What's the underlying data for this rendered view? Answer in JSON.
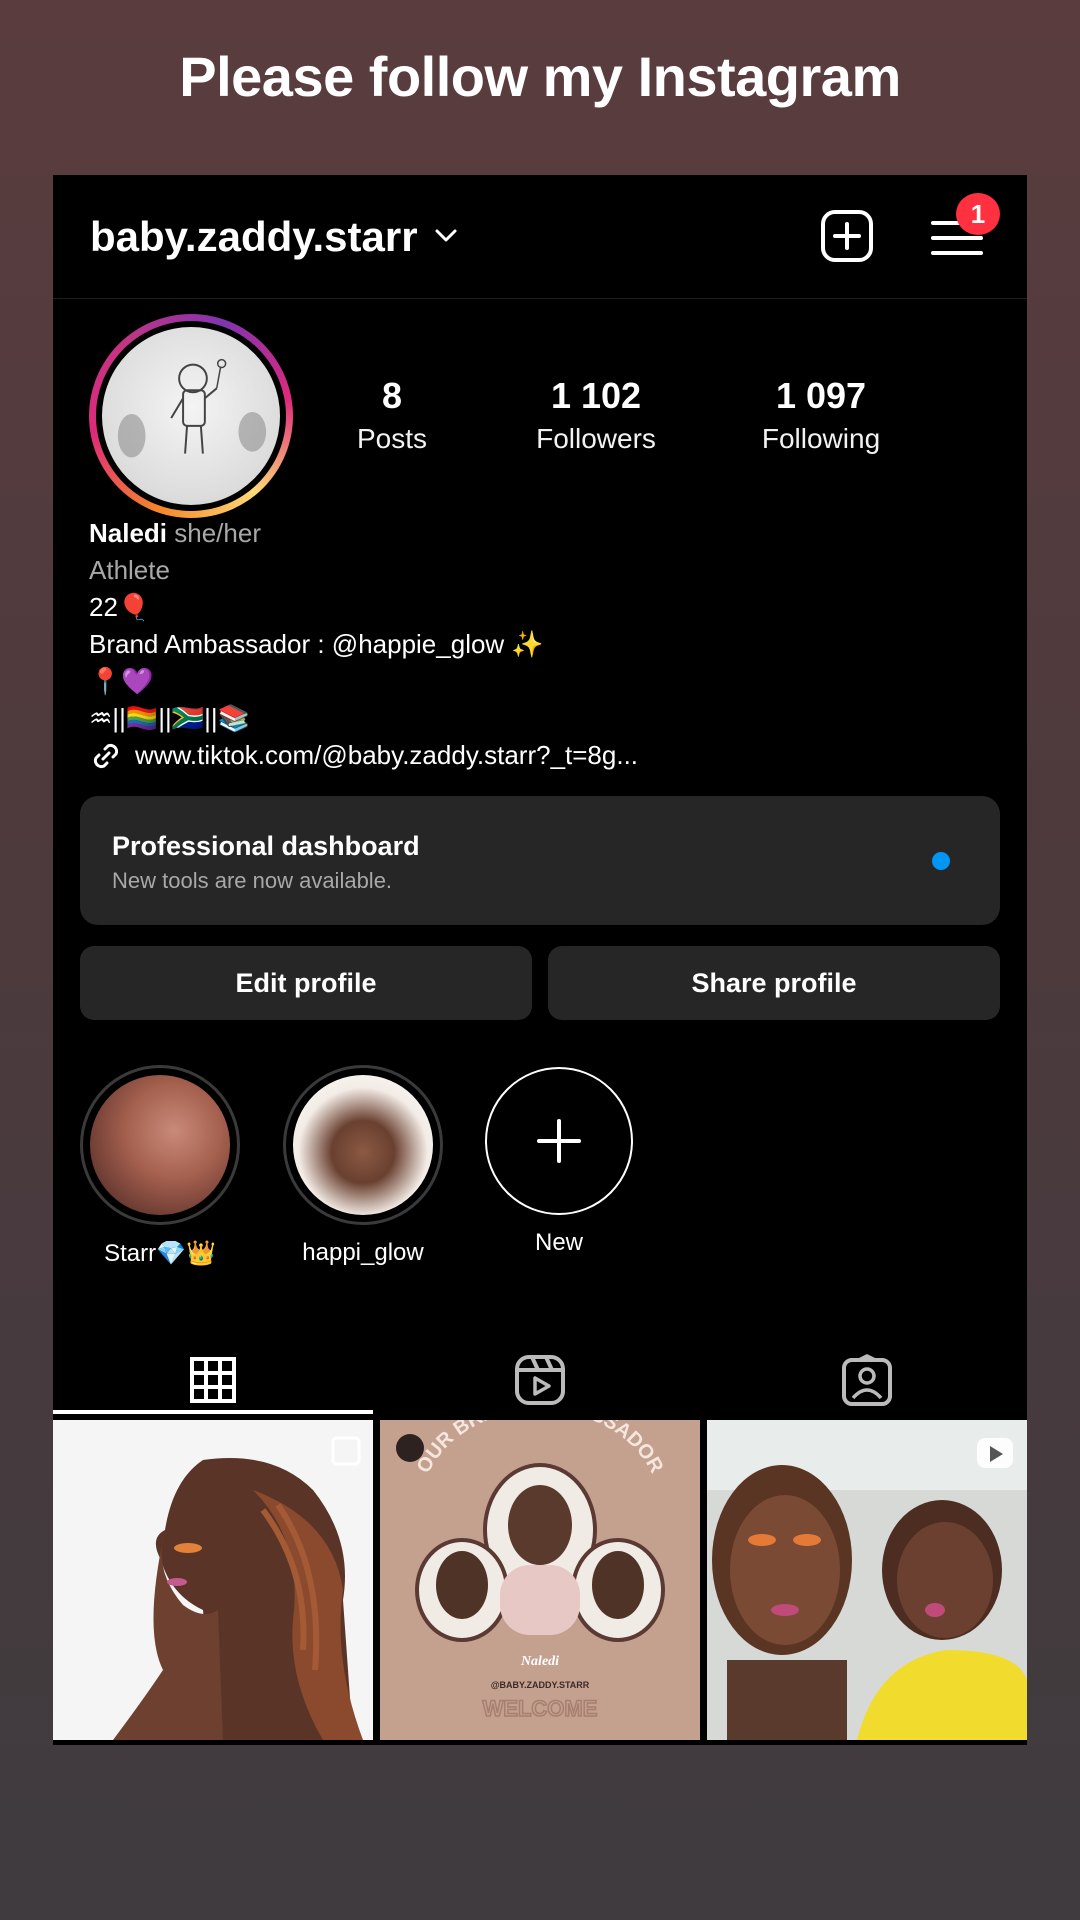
{
  "banner": {
    "text": "Please follow my Instagram"
  },
  "header": {
    "username": "baby.zaddy.starr",
    "notification_count": "1"
  },
  "stats": [
    {
      "value": "8",
      "label": "Posts"
    },
    {
      "value": "1 102",
      "label": "Followers"
    },
    {
      "value": "1 097",
      "label": "Following"
    }
  ],
  "bio": {
    "name": "Naledi",
    "pronouns": "she/her",
    "category": "Athlete",
    "line1": "22🎈",
    "line2": "Brand Ambassador : @happie_glow ✨",
    "line3": "📍💜",
    "line4": "♒||🏳️‍🌈||🇿🇦||📚",
    "link": "www.tiktok.com/@baby.zaddy.starr?_t=8g..."
  },
  "dashboard": {
    "title": "Professional dashboard",
    "subtitle": "New tools are now available."
  },
  "buttons": {
    "edit": "Edit profile",
    "share": "Share profile"
  },
  "highlights": [
    {
      "label": "Starr💎👑"
    },
    {
      "label": "happi_glow"
    },
    {
      "label": "New"
    }
  ],
  "posts": {
    "ambassador_heading": "OUR BRAND AMBASSADOR",
    "ambassador_name": "Naledi",
    "ambassador_handle": "@BABY.ZADDY.STARR",
    "ambassador_welcome": "WELCOME"
  },
  "colors": {
    "badge": "#ff3040",
    "dot": "#0095f6",
    "card": "#262626"
  }
}
